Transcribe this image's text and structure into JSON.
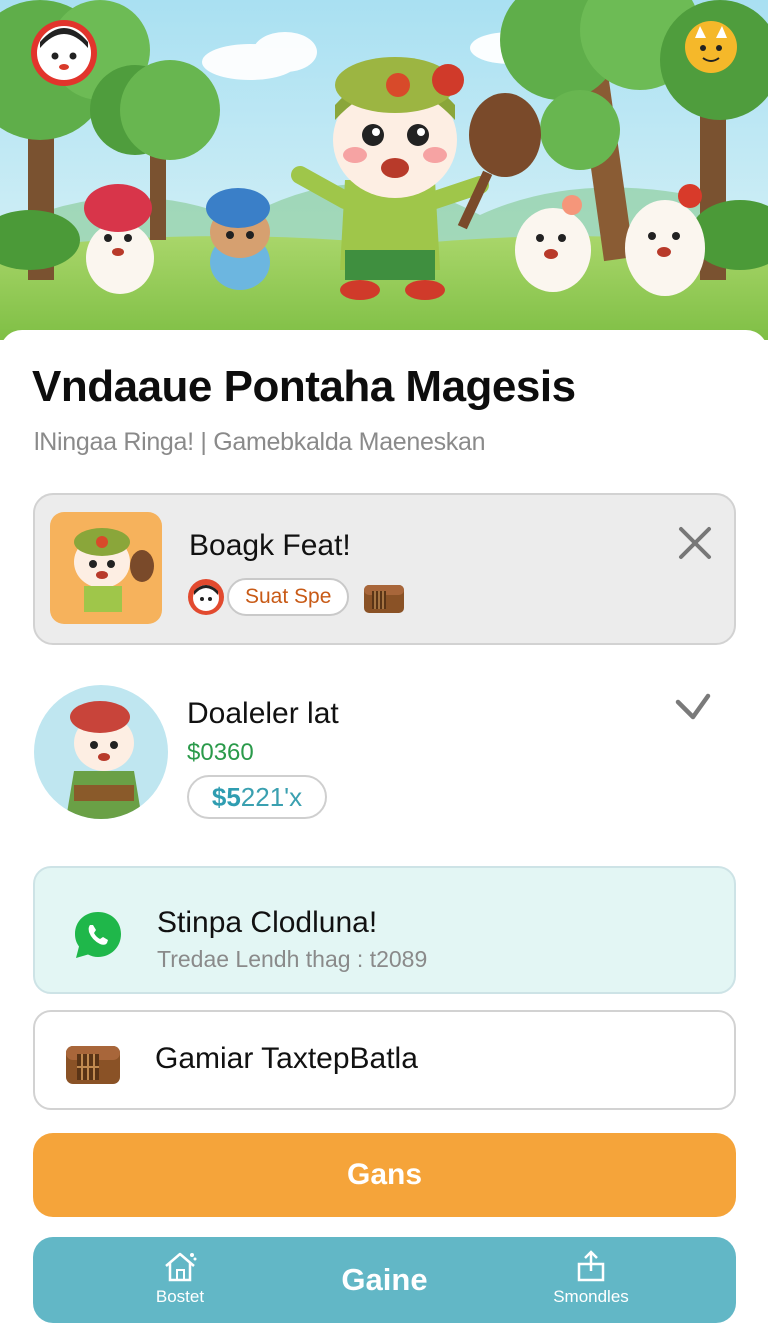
{
  "hero": {
    "profile_avatar": "avatar-icon",
    "badge_icon": "fox-badge-icon"
  },
  "header": {
    "title": "Vndaaue Pontaha Magesis",
    "subtitle": "lNingaa Ringa! | Gamebkalda Maeneskan"
  },
  "featured_card": {
    "title": "Boagk Feat!",
    "tag": "Suat Spe",
    "close_icon": "close-icon"
  },
  "item_row": {
    "title": "Doaleler lat",
    "price": "$0360",
    "pill_prefix": "$5",
    "pill_rest": "221'x",
    "chevron_icon": "chevron-down-icon"
  },
  "chat_card": {
    "title": "Stinpa Clodluna!",
    "subtitle": "Tredae Lendh thag :  t2089",
    "icon": "whatsapp-icon"
  },
  "chest_card": {
    "title": "Gamiar TaxtepBatla",
    "icon": "chest-icon"
  },
  "cta": {
    "label": "Gans",
    "color": "#f5a43a"
  },
  "nav": {
    "left_label": "Bostet",
    "center_label": "Gaine",
    "right_label": "Smondles",
    "color": "#62b7c6"
  }
}
